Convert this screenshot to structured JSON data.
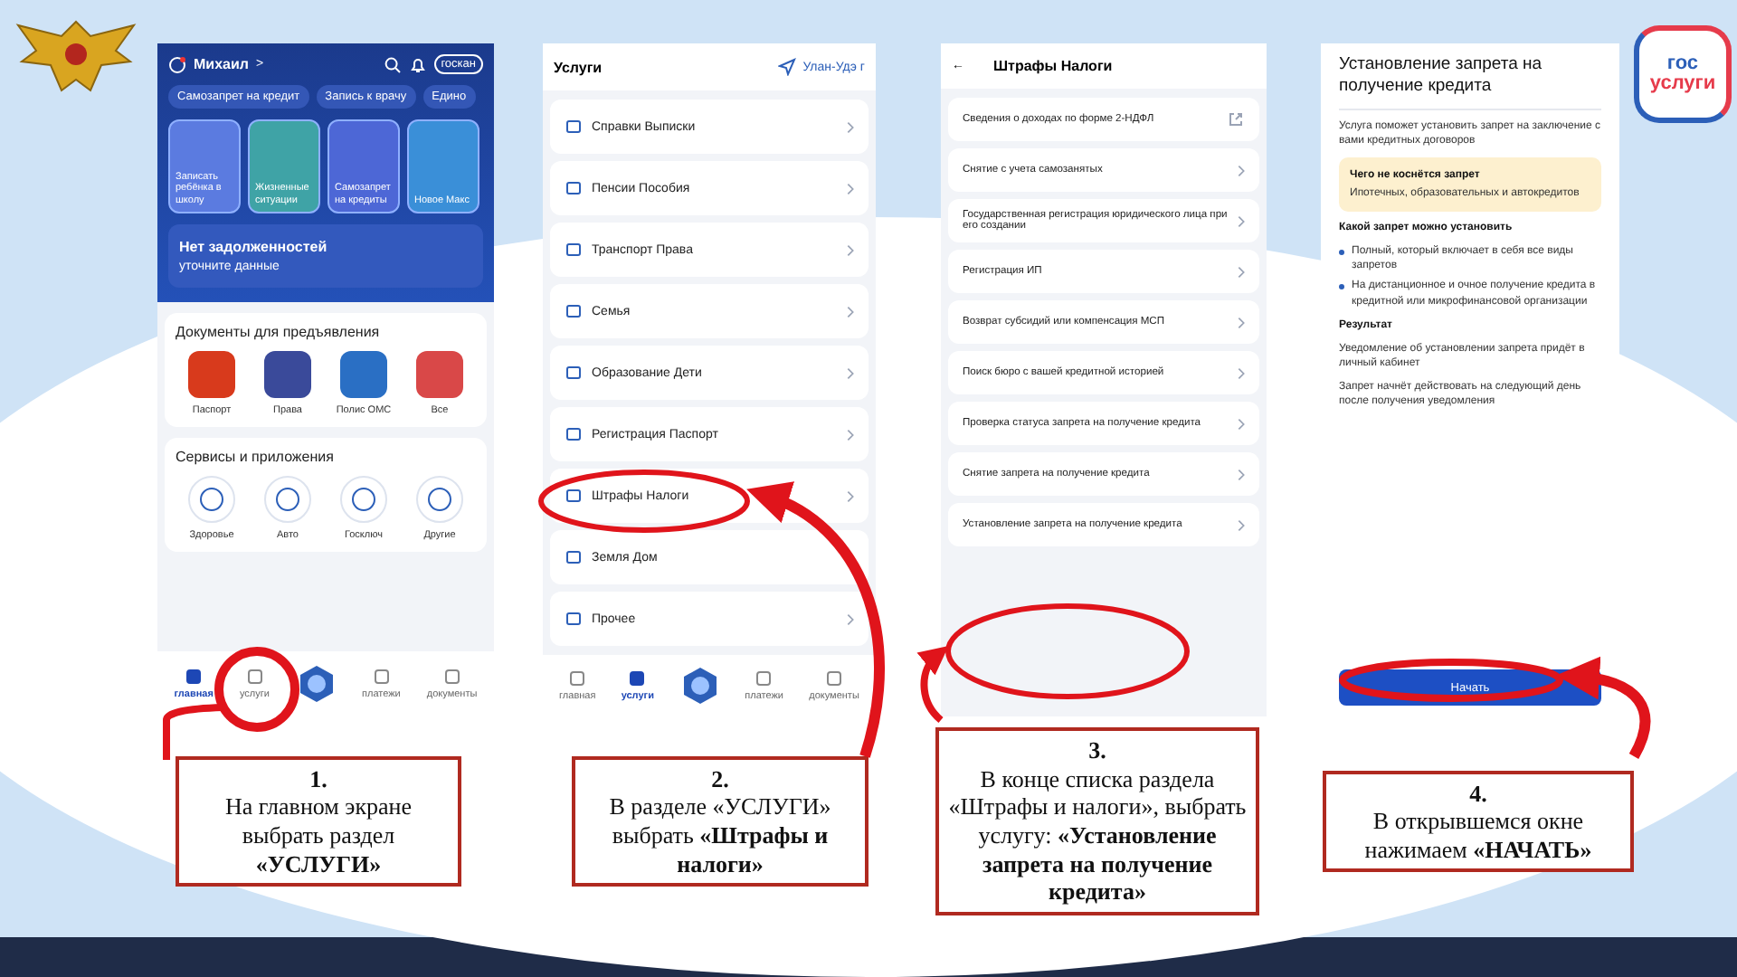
{
  "logo": {
    "line1": "гос",
    "line2": "услуги"
  },
  "home_screen": {
    "user": "Михаил",
    "user_chevron": ">",
    "scan_button": "госкан",
    "chips": [
      "Самозапрет на кредит",
      "Запись к врачу",
      "Едино"
    ],
    "stories": [
      {
        "label": "Записать ребёнка в школу",
        "color": "#5b7be0"
      },
      {
        "label": "Жизненные ситуации",
        "color": "#3fa3a6"
      },
      {
        "label": "Самозапрет на кредиты",
        "color": "#4d67d6"
      },
      {
        "label": "Новое Макс",
        "color": "#3a8fd8"
      }
    ],
    "debt_card": {
      "title": "Нет задолженностей",
      "subtitle": "уточните данные"
    },
    "documents": {
      "title": "Документы для предъявления",
      "items": [
        {
          "label": "Паспорт",
          "color": "#d83a1c"
        },
        {
          "label": "Права",
          "color": "#3a4a9a"
        },
        {
          "label": "Полис ОМС",
          "color": "#2a6fc4"
        },
        {
          "label": "Все",
          "color": "#d94848"
        }
      ]
    },
    "services": {
      "title": "Сервисы и приложения",
      "items": [
        "Здоровье",
        "Авто",
        "Госключ",
        "Другие"
      ]
    },
    "nav": [
      {
        "label": "главная",
        "selected": true
      },
      {
        "label": "услуги",
        "selected": false
      },
      {
        "label": "платежи",
        "selected": false
      },
      {
        "label": "документы",
        "selected": false
      }
    ]
  },
  "services_screen": {
    "title": "Услуги",
    "location": "Улан-Удэ г",
    "items": [
      "Справки Выписки",
      "Пенсии Пособия",
      "Транспорт Права",
      "Семья",
      "Образование Дети",
      "Регистрация Паспорт",
      "Штрафы Налоги",
      "Земля Дом",
      "Прочее"
    ],
    "nav": [
      {
        "label": "главная",
        "selected": false
      },
      {
        "label": "услуги",
        "selected": true
      },
      {
        "label": "платежи",
        "selected": false
      },
      {
        "label": "документы",
        "selected": false
      }
    ]
  },
  "fines_screen": {
    "back": "←",
    "title": "Штрафы Налоги",
    "items": [
      {
        "label": "Сведения о доходах по форме 2-НДФЛ",
        "kind": "external"
      },
      {
        "label": "Снятие с учета самозанятых",
        "kind": "link"
      },
      {
        "label": "Государственная регистрация юридического лица при его создании",
        "kind": "link"
      },
      {
        "label": "Регистрация ИП",
        "kind": "link"
      },
      {
        "label": "Возврат субсидий или компенсация МСП",
        "kind": "link"
      },
      {
        "label": "Поиск бюро с вашей кредитной историей",
        "kind": "link"
      },
      {
        "label": "Проверка статуса запрета на получение кредита",
        "kind": "link"
      },
      {
        "label": "Снятие запрета на получение кредита",
        "kind": "link"
      },
      {
        "label": "Установление запрета на получение кредита",
        "kind": "link"
      }
    ]
  },
  "service_page": {
    "title": "Установление запрета на получение кредита",
    "description": "Услуга поможет установить запрет на заключение с вами кредитных договоров",
    "notice": {
      "title": "Чего не коснётся запрет",
      "text": "Ипотечных, образовательных и автокредитов"
    },
    "options_title": "Какой запрет можно установить",
    "options": [
      "Полный, который включает в себя все виды запретов",
      "На дистанционное и очное получение кредита в кредитной или микрофинансовой организации"
    ],
    "result_title": "Результат",
    "result_texts": [
      "Уведомление об установлении запрета придёт в личный кабинет",
      "Запрет начнёт действовать на следующий день после получения уведомления"
    ],
    "button": "Начать"
  },
  "steps": [
    {
      "number": "1.",
      "text": "На главном экране выбрать раздел **«УСЛУГИ»**"
    },
    {
      "number": "2.",
      "text": "В разделе «УСЛУГИ» выбрать **«Штрафы и налоги»**"
    },
    {
      "number": "3.",
      "text": "В конце списка раздела «Штрафы и налоги», выбрать услугу: **«Установление запрета на получение кредита»**"
    },
    {
      "number": "4.",
      "text": "В открывшемся окне нажимаем **«НАЧАТЬ»**"
    }
  ]
}
